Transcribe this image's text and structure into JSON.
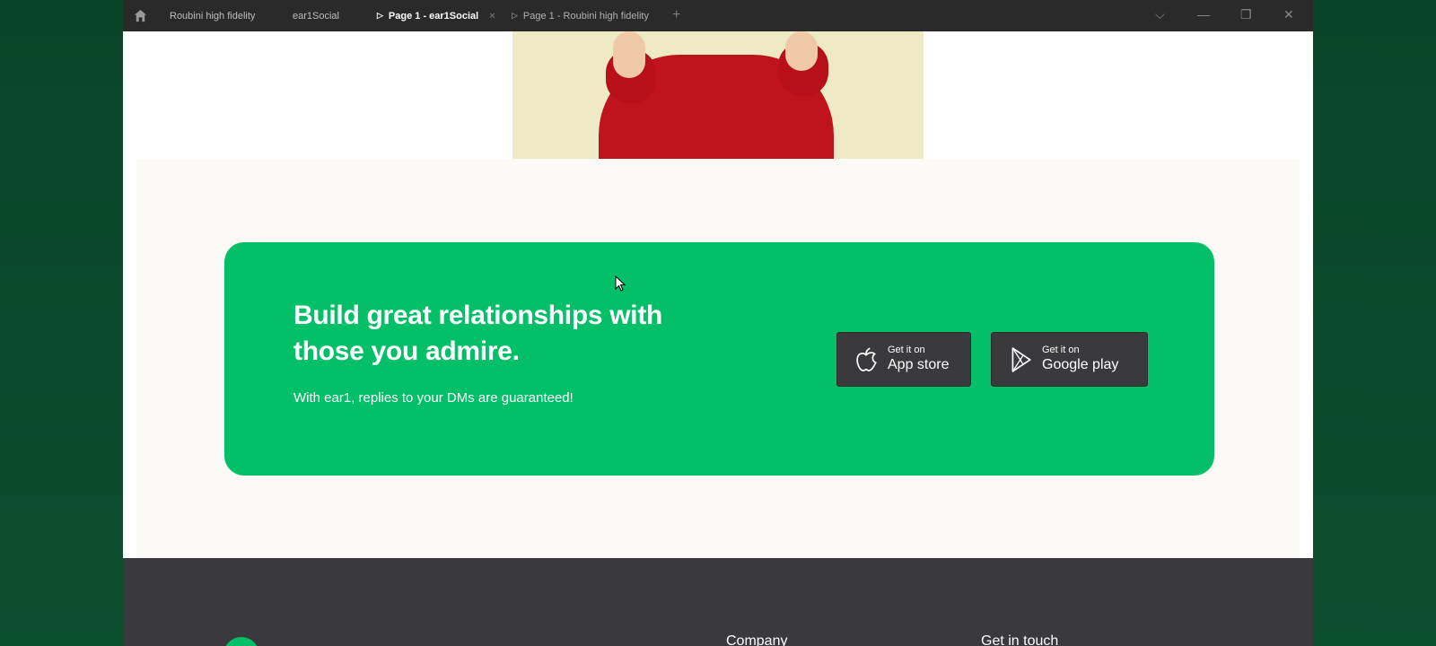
{
  "tabs": [
    {
      "label": "Roubini high fidelity",
      "has_play_icon": false,
      "active": false
    },
    {
      "label": "ear1Social",
      "has_play_icon": false,
      "active": false
    },
    {
      "label": "Page 1 - ear1Social",
      "has_play_icon": true,
      "active": true
    },
    {
      "label": "Page 1 - Roubini high fidelity",
      "has_play_icon": true,
      "active": false
    }
  ],
  "icons": {
    "home": "home-icon",
    "play": "play-icon",
    "close": "close-icon",
    "add": "plus-icon",
    "chevron": "chevron-down-icon",
    "minimize": "minimize-icon",
    "restore": "restore-icon",
    "apple": "apple-icon",
    "google_play": "google-play-icon"
  },
  "glyphs": {
    "play": "▷",
    "close": "×",
    "add": "+",
    "chevron": "⌵",
    "minimize": "—",
    "restore": "❐",
    "window_close": "✕"
  },
  "cta": {
    "heading": "Build great relationships with those you admire.",
    "subtext": "With ear1, replies to your DMs are guaranteed!",
    "buttons": [
      {
        "small": "Get it on",
        "big": "App store"
      },
      {
        "small": "Get it on",
        "big": "Google play"
      }
    ]
  },
  "footer": {
    "company_heading": "Company",
    "contact_heading": "Get in touch"
  },
  "colors": {
    "accent_green": "#03bf67",
    "desktop_green": "#0b4a2c",
    "titlebar": "#2a2a2a",
    "footer": "#3a393e",
    "button_dark": "#3a3a3d"
  }
}
